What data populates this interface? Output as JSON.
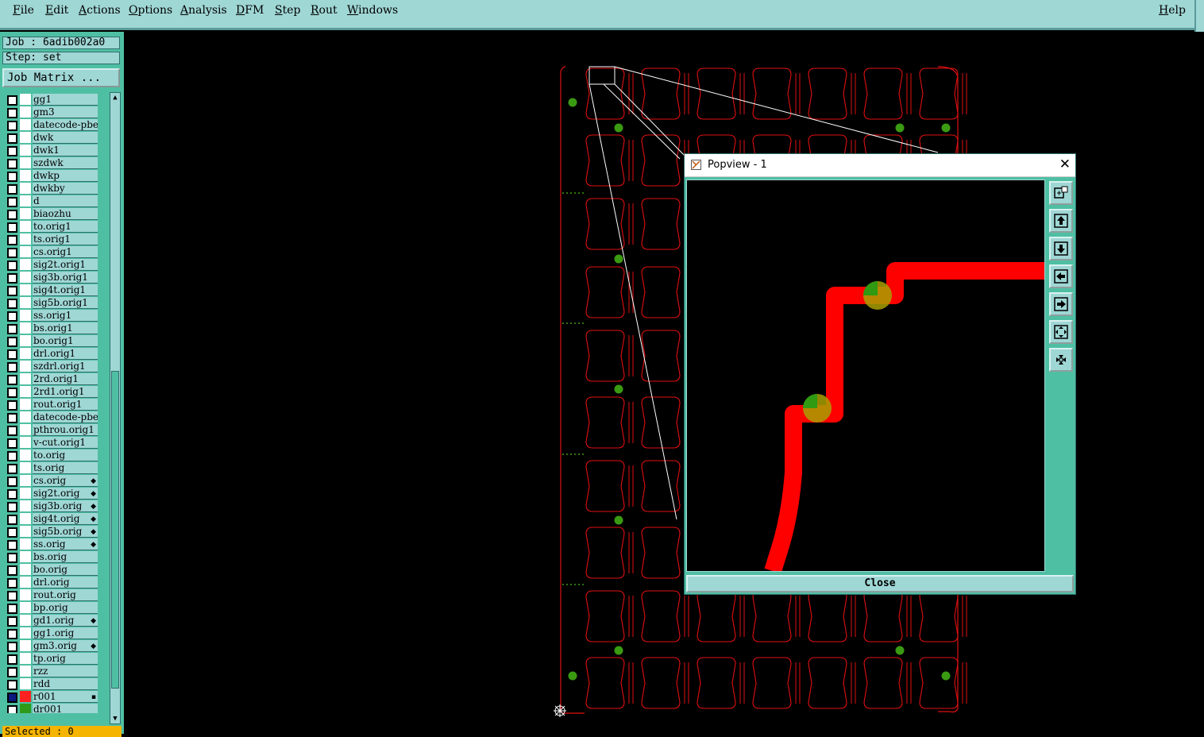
{
  "menu": {
    "items": [
      "File",
      "Edit",
      "Actions",
      "Options",
      "Analysis",
      "DFM",
      "Step",
      "Rout",
      "Windows"
    ],
    "help": "Help"
  },
  "panel": {
    "job": "Job : 6adib002a0",
    "step": "Step: set",
    "job_matrix": "Job Matrix ...",
    "status": "Selected : 0"
  },
  "layers": [
    {
      "name": "gg1",
      "mark": ""
    },
    {
      "name": "gm3",
      "mark": ""
    },
    {
      "name": "datecode-pbe",
      "mark": ""
    },
    {
      "name": "dwk",
      "mark": ""
    },
    {
      "name": "dwk1",
      "mark": ""
    },
    {
      "name": "szdwk",
      "mark": ""
    },
    {
      "name": "dwkp",
      "mark": ""
    },
    {
      "name": "dwkby",
      "mark": ""
    },
    {
      "name": "d",
      "mark": ""
    },
    {
      "name": "biaozhu",
      "mark": ""
    },
    {
      "name": "to.orig1",
      "mark": ""
    },
    {
      "name": "ts.orig1",
      "mark": ""
    },
    {
      "name": "cs.orig1",
      "mark": ""
    },
    {
      "name": "sig2t.orig1",
      "mark": ""
    },
    {
      "name": "sig3b.orig1",
      "mark": ""
    },
    {
      "name": "sig4t.orig1",
      "mark": ""
    },
    {
      "name": "sig5b.orig1",
      "mark": ""
    },
    {
      "name": "ss.orig1",
      "mark": ""
    },
    {
      "name": "bs.orig1",
      "mark": ""
    },
    {
      "name": "bo.orig1",
      "mark": ""
    },
    {
      "name": "drl.orig1",
      "mark": ""
    },
    {
      "name": "szdrl.orig1",
      "mark": ""
    },
    {
      "name": "2rd.orig1",
      "mark": ""
    },
    {
      "name": "2rd1.orig1",
      "mark": ""
    },
    {
      "name": "rout.orig1",
      "mark": ""
    },
    {
      "name": "datecode-pbe",
      "mark": ""
    },
    {
      "name": "pthrou.orig1",
      "mark": ""
    },
    {
      "name": "v-cut.orig1",
      "mark": ""
    },
    {
      "name": "to.orig",
      "mark": ""
    },
    {
      "name": "ts.orig",
      "mark": ""
    },
    {
      "name": "cs.orig",
      "mark": "◆"
    },
    {
      "name": "sig2t.orig",
      "mark": "◆"
    },
    {
      "name": "sig3b.orig",
      "mark": "◆"
    },
    {
      "name": "sig4t.orig",
      "mark": "◆"
    },
    {
      "name": "sig5b.orig",
      "mark": "◆"
    },
    {
      "name": "ss.orig",
      "mark": "◆"
    },
    {
      "name": "bs.orig",
      "mark": ""
    },
    {
      "name": "bo.orig",
      "mark": ""
    },
    {
      "name": "drl.orig",
      "mark": ""
    },
    {
      "name": "rout.orig",
      "mark": ""
    },
    {
      "name": "bp.orig",
      "mark": ""
    },
    {
      "name": "gd1.orig",
      "mark": "◆"
    },
    {
      "name": "gg1.orig",
      "mark": ""
    },
    {
      "name": "gm3.orig",
      "mark": "◆"
    },
    {
      "name": "tp.orig",
      "mark": ""
    },
    {
      "name": "rzz",
      "mark": ""
    },
    {
      "name": "rdd",
      "mark": ""
    },
    {
      "name": "r001",
      "mark": "▪",
      "color": "#ff2020",
      "active": true
    },
    {
      "name": "dr001",
      "mark": "",
      "color": "#2e9a1a"
    }
  ],
  "colors": {
    "outline": "#e01010",
    "pad": "#3a9a12",
    "trace": "#ff0000",
    "panel": "#9fd7d5",
    "panel_dark": "#4fbfa3"
  },
  "popview": {
    "title": "Popview - 1",
    "close_label": "Close",
    "tools": [
      "zoom-fit-icon",
      "pan-up-icon",
      "pan-down-icon",
      "pan-left-icon",
      "pan-right-icon",
      "zoom-in-icon",
      "zoom-out-icon"
    ]
  }
}
